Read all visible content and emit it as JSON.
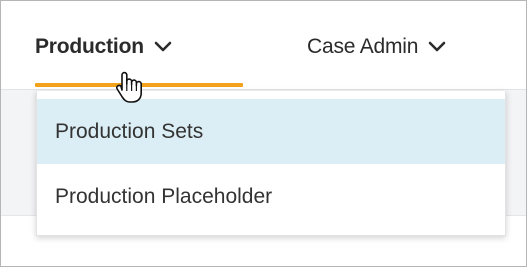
{
  "nav": {
    "items": [
      {
        "label": "Production",
        "active": true,
        "icon": "chevron-down-icon"
      },
      {
        "label": "Case Admin",
        "active": false,
        "icon": "chevron-down-icon"
      }
    ]
  },
  "dropdown": {
    "items": [
      {
        "label": "Production Sets",
        "highlighted": true
      },
      {
        "label": "Production Placeholder",
        "highlighted": false
      }
    ]
  },
  "cursor": {
    "icon": "hand-pointer-icon"
  },
  "colors": {
    "accent_underline": "#f2a21b",
    "highlight": "#dceef5",
    "text": "#2b2b2b",
    "content_band": "#f3f4f6"
  }
}
